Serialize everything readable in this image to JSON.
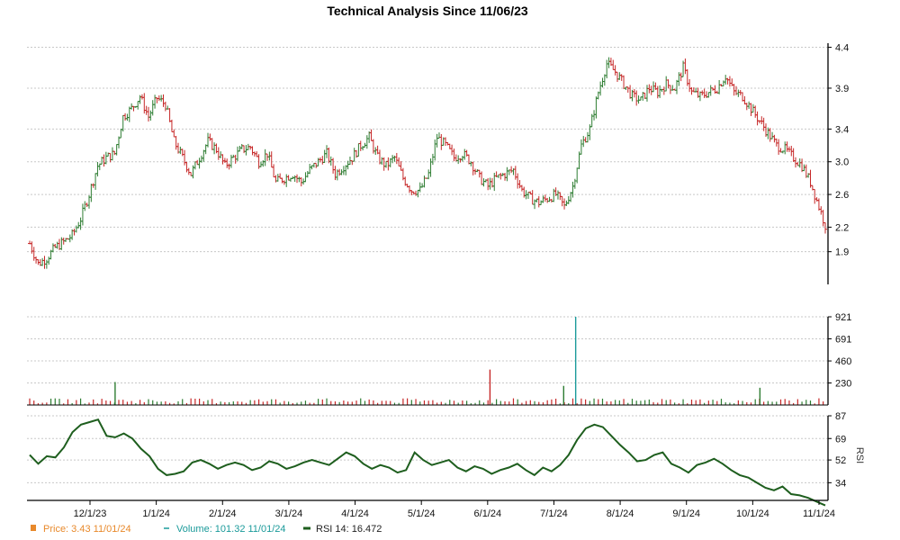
{
  "chart_data": {
    "type": "line",
    "title": "Technical Analysis Since 11/06/23",
    "x_tick_labels": [
      "12/1/23",
      "1/1/24",
      "2/1/24",
      "3/1/24",
      "4/1/24",
      "5/1/24",
      "6/1/24",
      "7/1/24",
      "8/1/24",
      "9/1/24",
      "10/1/24",
      "11/1/24"
    ],
    "price_panel": {
      "ylim": [
        1.5,
        4.45
      ],
      "y_ticks": [
        1.9,
        2.2,
        2.6,
        3.0,
        3.4,
        3.9,
        4.4
      ],
      "series": [
        {
          "key": "price",
          "type": "ohlc",
          "up_color": "#2e7d32",
          "down_color": "#c62828",
          "closes": [
            2.0,
            1.75,
            1.82,
            1.95,
            2.02,
            2.1,
            2.3,
            2.6,
            2.95,
            3.05,
            3.1,
            3.55,
            3.65,
            3.8,
            3.55,
            3.78,
            3.7,
            3.25,
            3.05,
            2.85,
            3.05,
            3.25,
            3.15,
            2.95,
            3.05,
            3.15,
            3.18,
            3.0,
            3.1,
            2.75,
            2.8,
            2.85,
            2.75,
            2.9,
            3.0,
            3.1,
            2.85,
            2.95,
            3.05,
            3.2,
            3.3,
            3.05,
            2.95,
            3.05,
            2.8,
            2.65,
            2.65,
            2.85,
            3.3,
            3.2,
            3.05,
            3.1,
            3.0,
            2.8,
            2.7,
            2.8,
            2.85,
            2.9,
            2.65,
            2.55,
            2.5,
            2.55,
            2.6,
            2.45,
            2.7,
            3.2,
            3.4,
            3.85,
            4.2,
            4.1,
            3.95,
            3.8,
            3.75,
            3.9,
            3.85,
            3.95,
            3.9,
            4.15,
            3.85,
            3.8,
            3.85,
            3.9,
            4.05,
            3.85,
            3.8,
            3.65,
            3.5,
            3.35,
            3.2,
            3.15,
            3.05,
            2.95,
            2.75,
            2.45
          ]
        }
      ]
    },
    "volume_panel": {
      "ylim": [
        0,
        921
      ],
      "y_ticks": [
        230,
        460,
        691,
        921
      ],
      "spikes": [
        {
          "x": 0.11,
          "v": 240
        },
        {
          "x": 0.578,
          "v": 370
        },
        {
          "x": 0.67,
          "v": 200
        },
        {
          "x": 0.685,
          "v": 921
        },
        {
          "x": 0.915,
          "v": 180
        }
      ]
    },
    "rsi_panel": {
      "ylim": [
        20,
        87
      ],
      "y_ticks": [
        34,
        52,
        69,
        87
      ],
      "ylabel": "RSI",
      "values": [
        56,
        49,
        55,
        54,
        62,
        74,
        80,
        82,
        84,
        71,
        70,
        73,
        69,
        61,
        55,
        45,
        40,
        41,
        43,
        50,
        52,
        49,
        45,
        48,
        50,
        48,
        44,
        46,
        51,
        49,
        45,
        47,
        50,
        52,
        50,
        48,
        53,
        58,
        55,
        49,
        45,
        48,
        46,
        42,
        44,
        58,
        52,
        48,
        50,
        52,
        46,
        43,
        47,
        45,
        41,
        44,
        46,
        49,
        44,
        40,
        46,
        43,
        48,
        56,
        68,
        77,
        80,
        78,
        71,
        64,
        58,
        51,
        52,
        56,
        58,
        49,
        46,
        42,
        48,
        50,
        53,
        49,
        44,
        40,
        38,
        34,
        30,
        28,
        31,
        25,
        24,
        22,
        19,
        16
      ]
    },
    "legend": [
      {
        "label": "Price: 3.43  11/01/24",
        "color": "#e8892b",
        "marker": "square"
      },
      {
        "label": "Volume: 101.32  11/01/24",
        "color": "#1a9a9a",
        "marker": "dash"
      },
      {
        "label": "RSI 14: 16.472",
        "color": "#1e5e1e",
        "marker": "thick-line"
      }
    ]
  }
}
